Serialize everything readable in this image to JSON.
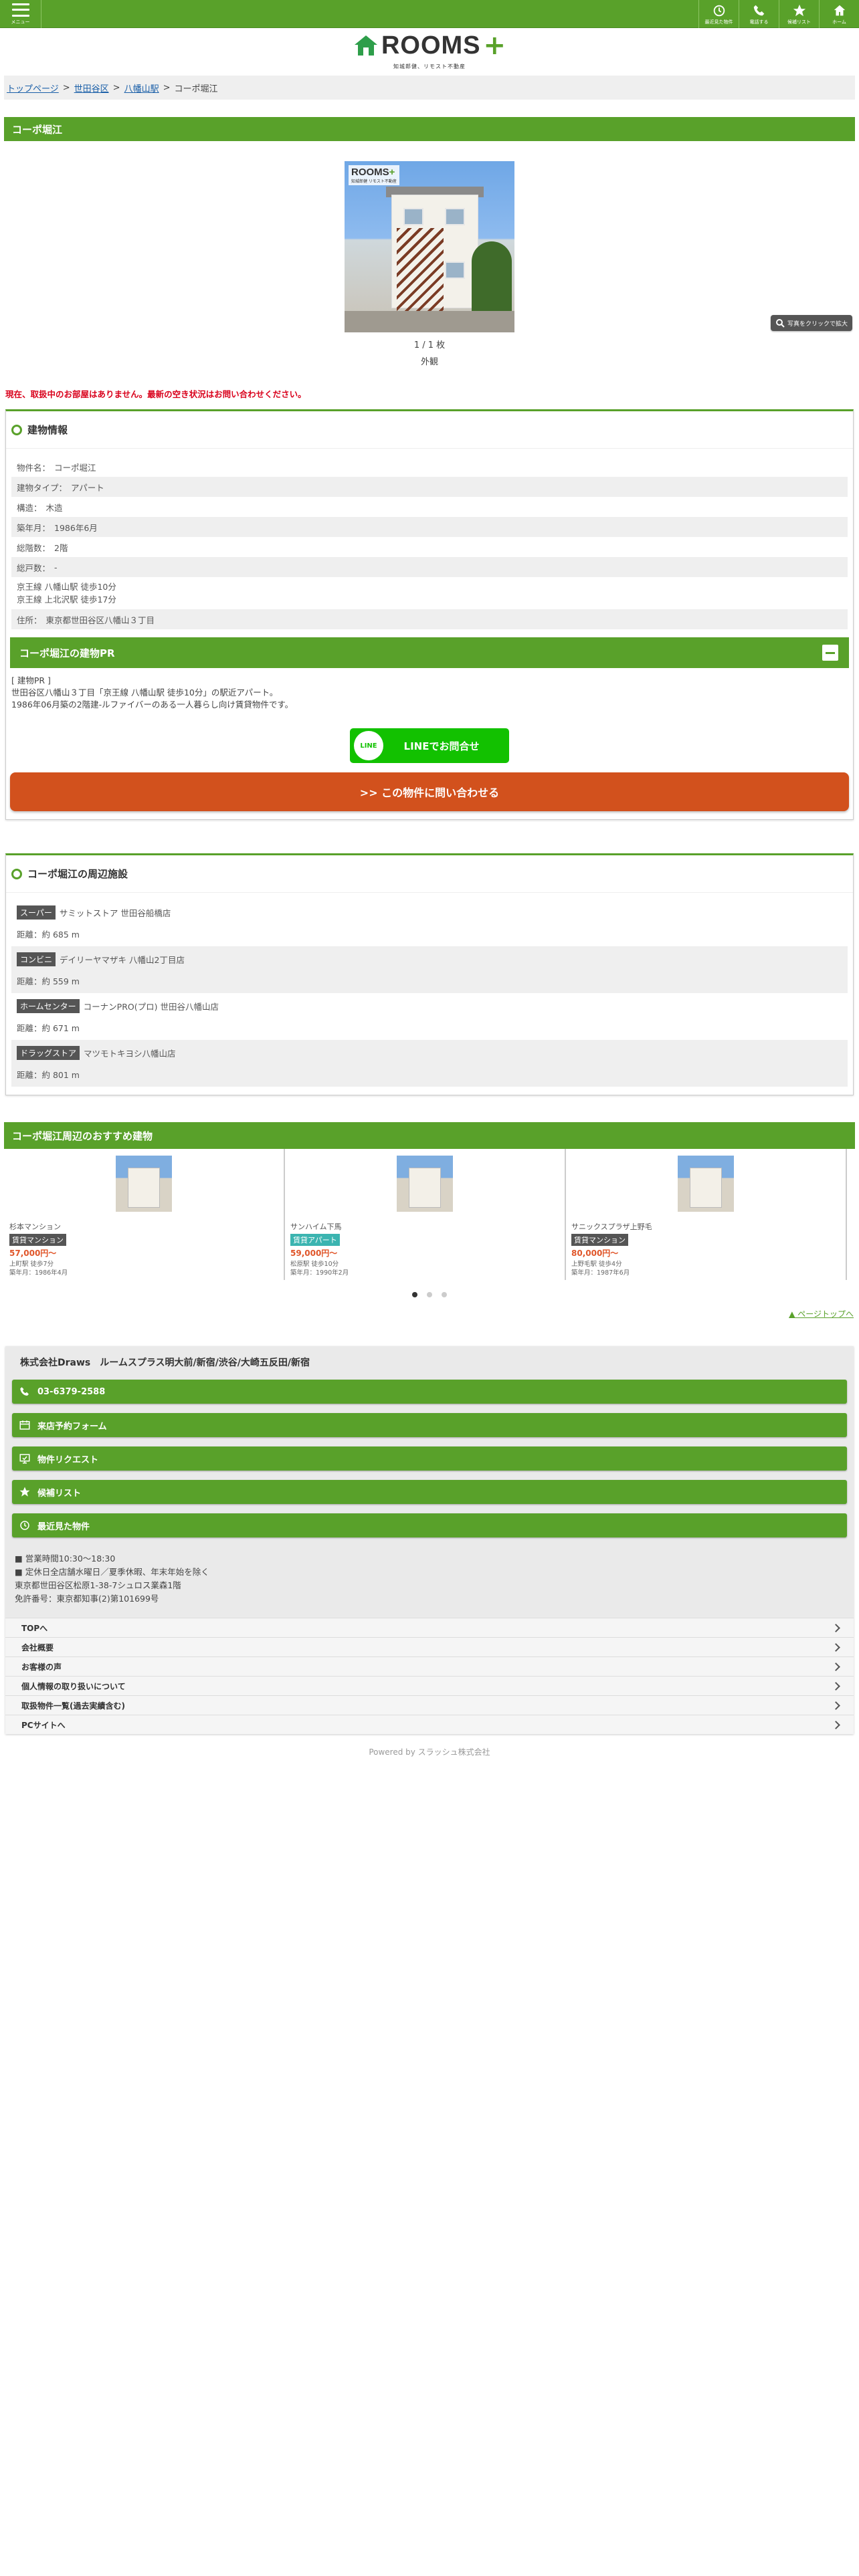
{
  "header": {
    "menu_label": "メニュー",
    "buttons": [
      {
        "label": "最近見た物件"
      },
      {
        "label": "電話する"
      },
      {
        "label": "候補リスト"
      },
      {
        "label": "ホーム"
      }
    ]
  },
  "logo": {
    "word": "ROOMS",
    "plus": "+",
    "subtitle": "知城郎健、リモスト不動産"
  },
  "breadcrumb": {
    "home": "トップページ",
    "ward": "世田谷区",
    "station": "八幡山駅",
    "current": "コーポ堀江"
  },
  "page_title": "コーポ堀江",
  "photo": {
    "watermark_word": "ROOMS",
    "watermark_plus": "+",
    "watermark_sub": "知城郎健 リモスト不動産",
    "zoom_label": "写真をクリックで拡大",
    "count": "1 / 1 枚",
    "caption": "外観"
  },
  "notice": "現在、取扱中のお部屋はありません。最新の空き状況はお問い合わせください。",
  "building_info": {
    "heading": "建物情報",
    "rows": [
      {
        "k": "物件名：",
        "v": "コーポ堀江"
      },
      {
        "k": "建物タイプ：",
        "v": "アパート"
      },
      {
        "k": "構造：",
        "v": "木造"
      },
      {
        "k": "築年月：",
        "v": "1986年6月"
      },
      {
        "k": "総階数：",
        "v": "2階"
      },
      {
        "k": "総戸数：",
        "v": "-"
      },
      {
        "k": "京王線 八幡山駅 徒歩10分",
        "v": ""
      },
      {
        "k": "住所：",
        "v": "東京都世田谷区八幡山３丁目"
      }
    ],
    "access_line2": "京王線 上北沢駅 徒歩17分",
    "pr_heading": "コーポ堀江の建物PR",
    "pr_line1": "[ 建物PR ]",
    "pr_line2": "世田谷区八幡山３丁目「京王線 八幡山駅 徒歩10分」の駅近アパート。",
    "pr_line3": "1986年06月築の2階建-ルファイバーのある一人暮らし向け賃貸物件です。",
    "line_icon": "LINE",
    "line_button": "LINEでお問合せ",
    "inquiry_button": ">> この物件に問い合わせる"
  },
  "facilities": {
    "heading": "コーポ堀江の周辺施設",
    "items": [
      {
        "cat": "スーパー",
        "name": "サミットストア 世田谷船橋店",
        "dist": "距離：約 685 m"
      },
      {
        "cat": "コンビニ",
        "name": "デイリーヤマザキ 八幡山2丁目店",
        "dist": "距離：約 559 m"
      },
      {
        "cat": "ホームセンター",
        "name": "コーナンPRO(プロ) 世田谷八幡山店",
        "dist": "距離：約 671 m"
      },
      {
        "cat": "ドラッグストア",
        "name": "マツモトキヨシ八幡山店",
        "dist": "距離：約 801 m"
      }
    ]
  },
  "recommend": {
    "heading": "コーポ堀江周辺のおすすめ建物",
    "cards": [
      {
        "name": "杉本マンション",
        "tag": "賃貸マンション",
        "tag_color": "#555555",
        "price": "57,000円〜",
        "line1": "上町駅 徒歩7分",
        "line2": "築年月：1986年4月"
      },
      {
        "name": "サンハイム下馬",
        "tag": "賃貸アパート",
        "tag_color": "#3bb4b0",
        "price": "59,000円〜",
        "line1": "松原駅 徒歩10分",
        "line2": "築年月：1990年2月"
      },
      {
        "name": "サニックスプラザ上野毛",
        "tag": "賃貸マンション",
        "tag_color": "#555555",
        "price": "80,000円〜",
        "line1": "上野毛駅 徒歩4分",
        "line2": "築年月：1987年6月"
      }
    ],
    "pagetop": "▲ ページトップへ"
  },
  "footer": {
    "company": "株式会社Draws　ルームスプラス明大前/新宿/渋谷/大崎五反田/新宿",
    "buttons": [
      {
        "label": "03-6379-2588",
        "icon": "phone-icon"
      },
      {
        "label": "来店予約フォーム",
        "icon": "calendar-icon"
      },
      {
        "label": "物件リクエスト",
        "icon": "request-icon"
      },
      {
        "label": "候補リスト",
        "icon": "star-icon"
      },
      {
        "label": "最近見た物件",
        "icon": "history-icon"
      }
    ],
    "info": [
      "■ 営業時間10:30〜18:30",
      "■ 定休日全店舗水曜日／夏季休暇、年末年始を除く",
      "東京都世田谷区松原1-38-7シュロス業森1階",
      "免許番号：東京都知事(2)第101699号"
    ],
    "links": [
      "TOPへ",
      "会社概要",
      "お客様の声",
      "個人情報の取り扱いについて",
      "取扱物件一覧(過去実績含む)",
      "PCサイトへ"
    ],
    "powered": "Powered by スラッシュ株式会社"
  },
  "colors": {
    "primary": "#59a12a",
    "accent": "#d2511d",
    "line": "#12c100",
    "notice": "#d9001b"
  }
}
